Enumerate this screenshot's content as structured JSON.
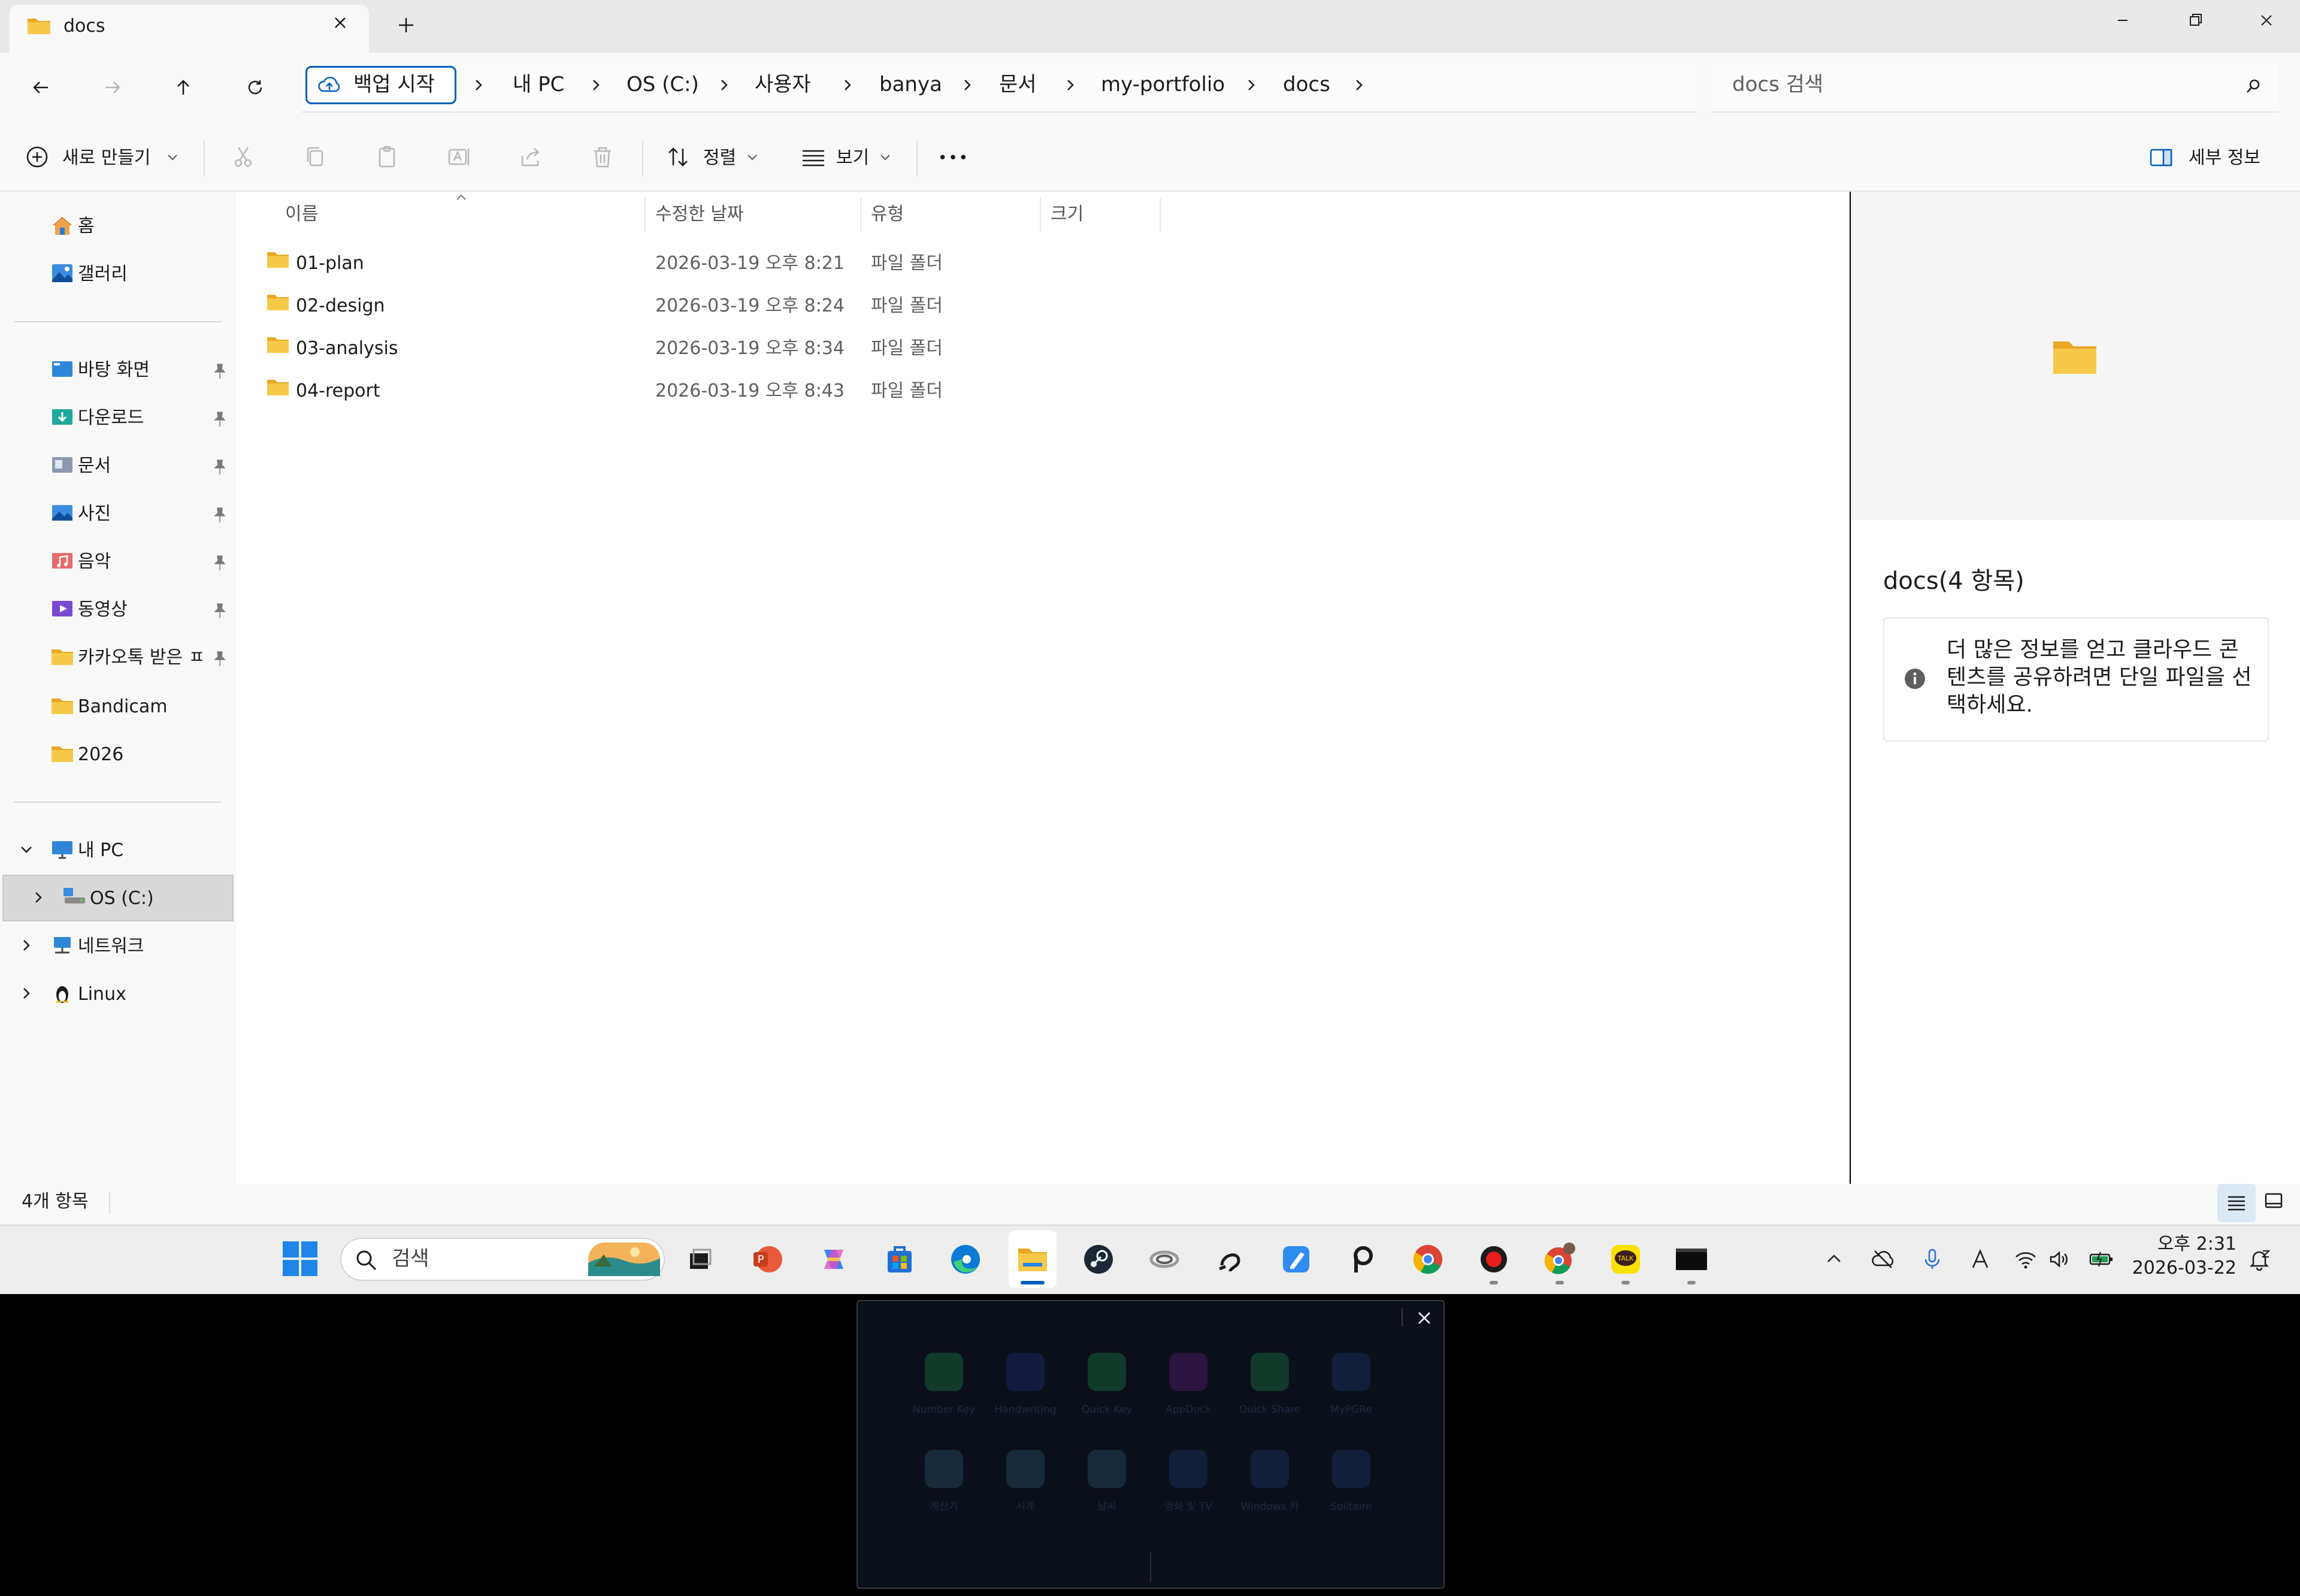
{
  "window": {
    "tab_title": "docs",
    "controls": [
      "minimize",
      "maximize",
      "close"
    ]
  },
  "address_bar": {
    "backup_label": "백업 시작",
    "breadcrumbs": [
      "내 PC",
      "OS (C:)",
      "사용자",
      "banya",
      "문서",
      "my-portfolio",
      "docs"
    ],
    "search_placeholder": "docs 검색"
  },
  "command_bar": {
    "new_label": "새로 만들기",
    "sort_label": "정렬",
    "view_label": "보기",
    "more_label": "•••",
    "details_label": "세부 정보"
  },
  "nav": {
    "top_items": [
      {
        "label": "홈",
        "icon": "home-icon"
      },
      {
        "label": "갤러리",
        "icon": "gallery-icon"
      }
    ],
    "quick_access": [
      {
        "label": "바탕 화면",
        "icon": "desktop-icon",
        "pinned": true
      },
      {
        "label": "다운로드",
        "icon": "download-icon",
        "pinned": true
      },
      {
        "label": "문서",
        "icon": "documents-icon",
        "pinned": true
      },
      {
        "label": "사진",
        "icon": "pictures-icon",
        "pinned": true
      },
      {
        "label": "음악",
        "icon": "music-icon",
        "pinned": true
      },
      {
        "label": "동영상",
        "icon": "videos-icon",
        "pinned": true
      },
      {
        "label": "카카오톡 받은 ㅍ",
        "icon": "folder-icon",
        "pinned": true
      },
      {
        "label": "Bandicam",
        "icon": "folder-icon",
        "pinned": false
      },
      {
        "label": "2026",
        "icon": "folder-icon",
        "pinned": false
      }
    ],
    "tree": [
      {
        "label": "내 PC",
        "icon": "pc-icon",
        "expanded": true
      },
      {
        "label": "OS (C:)",
        "icon": "drive-icon",
        "selected": true
      },
      {
        "label": "네트워크",
        "icon": "network-icon"
      },
      {
        "label": "Linux",
        "icon": "linux-icon"
      }
    ]
  },
  "list": {
    "columns": [
      "이름",
      "수정한 날짜",
      "유형",
      "크기"
    ],
    "rows": [
      {
        "name": "01-plan",
        "date": "2026-03-19 오후 8:21",
        "type": "파일 폴더"
      },
      {
        "name": "02-design",
        "date": "2026-03-19 오후 8:24",
        "type": "파일 폴더"
      },
      {
        "name": "03-analysis",
        "date": "2026-03-19 오후 8:34",
        "type": "파일 폴더"
      },
      {
        "name": "04-report",
        "date": "2026-03-19 오후 8:43",
        "type": "파일 폴더"
      }
    ]
  },
  "details_pane": {
    "title": "docs(4 항목)",
    "info": "더 많은 정보를 얻고 클라우드 콘텐츠를 공유하려면 단일 파일을 선택하세요."
  },
  "status": {
    "count": "4개 항목"
  },
  "taskbar": {
    "search_label": "검색",
    "apps": [
      "task-view-icon",
      "powerpoint-icon",
      "copilot-icon",
      "store-icon",
      "edge-icon",
      "file-explorer-icon",
      "steam-icon",
      "link-icon",
      "app-icon",
      "pen-app-icon",
      "p-app-icon",
      "chrome-icon",
      "record-icon",
      "chrome-profile-icon",
      "kakaotalk-icon",
      "terminal-icon"
    ],
    "kakao_label": "TALK",
    "clock_time": "오후 2:31",
    "clock_date": "2026-03-22"
  },
  "overlay": {
    "labels_row1": [
      "Number Key",
      "Handwriting",
      "Quick Key",
      "AppDock",
      "Quick Share",
      "MyPGRe"
    ],
    "labels_row2": [
      "계산기",
      "시계",
      "날씨",
      "영화 및 TV",
      "Windows 카",
      "Solitaire"
    ]
  },
  "colors": {
    "accent": "#005fb8",
    "folder": "#f4c33d",
    "selection": "#d9d9d9"
  }
}
